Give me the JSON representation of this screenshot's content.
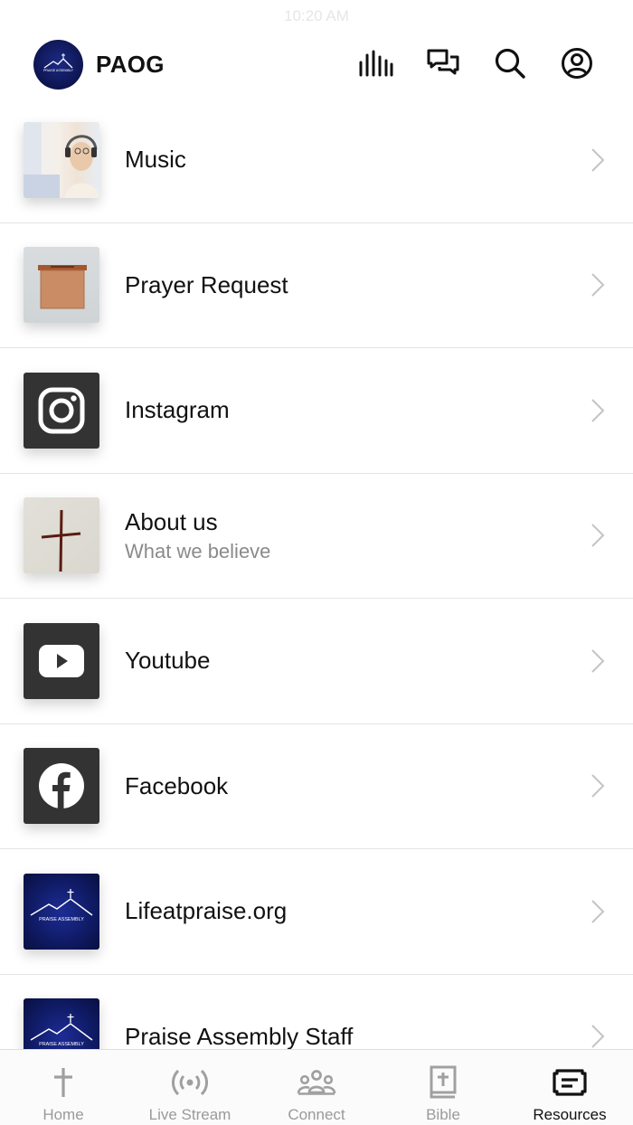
{
  "status_bar": {
    "time": "10:20 AM"
  },
  "header": {
    "app_title": "PAOG",
    "logo_text": "PRAISE ASSEMBLY",
    "icons": [
      "equalizer-icon",
      "chat-icon",
      "search-icon",
      "profile-icon"
    ]
  },
  "list": {
    "items": [
      {
        "title": "Music",
        "subtitle": "",
        "thumb": "music-photo"
      },
      {
        "title": "Prayer Request",
        "subtitle": "",
        "thumb": "prayer-box-photo"
      },
      {
        "title": "Instagram",
        "subtitle": "",
        "thumb": "instagram-icon"
      },
      {
        "title": "About us",
        "subtitle": "What we believe",
        "thumb": "cross-photo"
      },
      {
        "title": "Youtube",
        "subtitle": "",
        "thumb": "youtube-icon"
      },
      {
        "title": "Facebook",
        "subtitle": "",
        "thumb": "facebook-icon"
      },
      {
        "title": "Lifeatpraise.org",
        "subtitle": "",
        "thumb": "praise-assembly-logo"
      },
      {
        "title": "Praise Assembly Staff",
        "subtitle": "",
        "thumb": "praise-assembly-logo"
      }
    ]
  },
  "tabbar": {
    "tabs": [
      {
        "label": "Home",
        "icon": "cross-icon",
        "active": false
      },
      {
        "label": "Live Stream",
        "icon": "broadcast-icon",
        "active": false
      },
      {
        "label": "Connect",
        "icon": "group-icon",
        "active": false
      },
      {
        "label": "Bible",
        "icon": "bible-icon",
        "active": false
      },
      {
        "label": "Resources",
        "icon": "resources-icon",
        "active": true
      }
    ]
  },
  "colors": {
    "thumb_dark": "#333333",
    "logo_navy": "#0d154f",
    "active_tab": "#111111",
    "inactive_tab": "#9a9a9a"
  }
}
